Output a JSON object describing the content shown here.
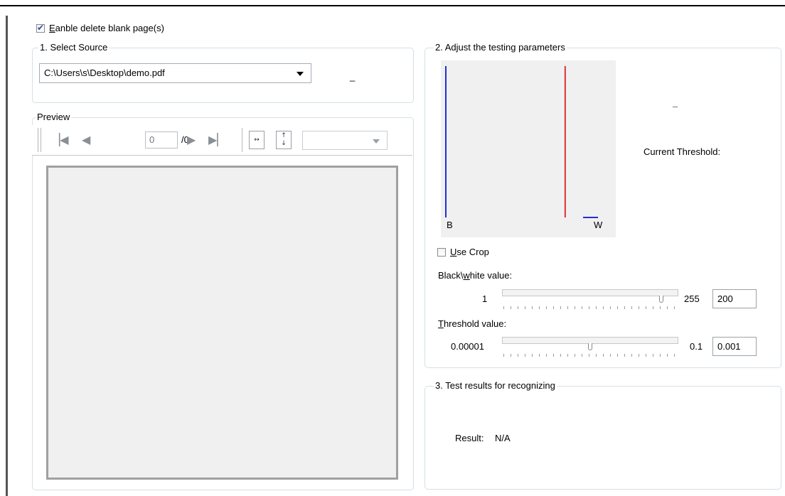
{
  "enable": {
    "label": "Eanble delete blank page(s)",
    "checked": true
  },
  "source": {
    "legend": "1. Select Source",
    "file": "C:\\Users\\s\\Desktop\\demo.pdf",
    "dash": "_"
  },
  "preview": {
    "legend": "Preview",
    "page_input": "0",
    "page_total": "/0",
    "zoom_select": ""
  },
  "params": {
    "legend": "2. Adjust the testing parameters",
    "histogram": {
      "left_label": "B",
      "right_label": "W",
      "threshold_value": 200,
      "max": 255
    },
    "dash": "–",
    "current_threshold_label": "Current Threshold:",
    "use_crop": {
      "label": "Use Crop",
      "checked": false
    },
    "bw": {
      "label": "Black\\white  value:",
      "min": "1",
      "max": "255",
      "value": "200",
      "slider_fraction": 0.92
    },
    "threshold": {
      "label": "Threshold value:",
      "min": "0.00001",
      "max": "0.1",
      "value": "0.001",
      "slider_fraction": 0.5
    }
  },
  "results": {
    "legend": "3. Test results for recognizing",
    "result_label": "Result:",
    "result_value": "N/A"
  },
  "colors": {
    "histo_blue": "#1f2fd4",
    "histo_red": "#e03030",
    "group_border": "#d5dfe5"
  }
}
